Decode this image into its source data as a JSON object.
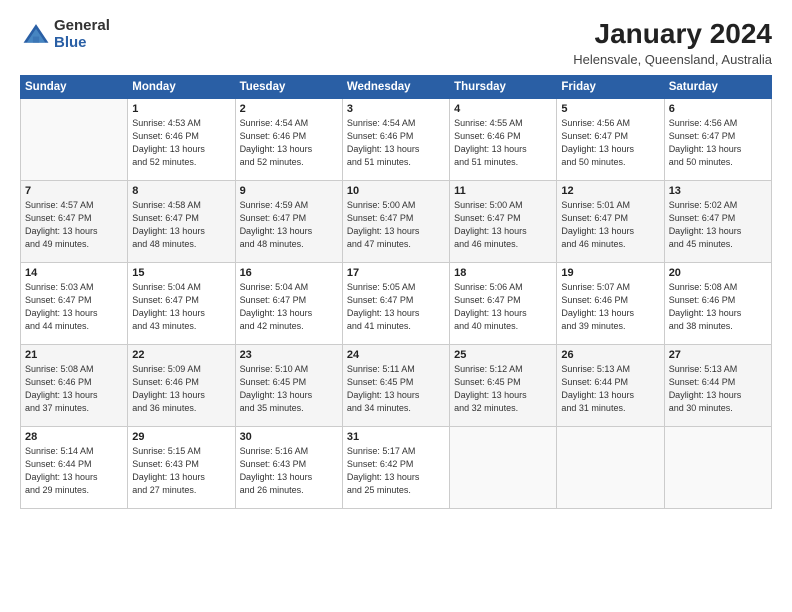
{
  "logo": {
    "general": "General",
    "blue": "Blue"
  },
  "title": {
    "month_year": "January 2024",
    "location": "Helensvale, Queensland, Australia"
  },
  "header_days": [
    "Sunday",
    "Monday",
    "Tuesday",
    "Wednesday",
    "Thursday",
    "Friday",
    "Saturday"
  ],
  "weeks": [
    {
      "days": [
        {
          "num": "",
          "content": ""
        },
        {
          "num": "1",
          "content": "Sunrise: 4:53 AM\nSunset: 6:46 PM\nDaylight: 13 hours\nand 52 minutes."
        },
        {
          "num": "2",
          "content": "Sunrise: 4:54 AM\nSunset: 6:46 PM\nDaylight: 13 hours\nand 52 minutes."
        },
        {
          "num": "3",
          "content": "Sunrise: 4:54 AM\nSunset: 6:46 PM\nDaylight: 13 hours\nand 51 minutes."
        },
        {
          "num": "4",
          "content": "Sunrise: 4:55 AM\nSunset: 6:46 PM\nDaylight: 13 hours\nand 51 minutes."
        },
        {
          "num": "5",
          "content": "Sunrise: 4:56 AM\nSunset: 6:47 PM\nDaylight: 13 hours\nand 50 minutes."
        },
        {
          "num": "6",
          "content": "Sunrise: 4:56 AM\nSunset: 6:47 PM\nDaylight: 13 hours\nand 50 minutes."
        }
      ]
    },
    {
      "days": [
        {
          "num": "7",
          "content": "Sunrise: 4:57 AM\nSunset: 6:47 PM\nDaylight: 13 hours\nand 49 minutes."
        },
        {
          "num": "8",
          "content": "Sunrise: 4:58 AM\nSunset: 6:47 PM\nDaylight: 13 hours\nand 48 minutes."
        },
        {
          "num": "9",
          "content": "Sunrise: 4:59 AM\nSunset: 6:47 PM\nDaylight: 13 hours\nand 48 minutes."
        },
        {
          "num": "10",
          "content": "Sunrise: 5:00 AM\nSunset: 6:47 PM\nDaylight: 13 hours\nand 47 minutes."
        },
        {
          "num": "11",
          "content": "Sunrise: 5:00 AM\nSunset: 6:47 PM\nDaylight: 13 hours\nand 46 minutes."
        },
        {
          "num": "12",
          "content": "Sunrise: 5:01 AM\nSunset: 6:47 PM\nDaylight: 13 hours\nand 46 minutes."
        },
        {
          "num": "13",
          "content": "Sunrise: 5:02 AM\nSunset: 6:47 PM\nDaylight: 13 hours\nand 45 minutes."
        }
      ]
    },
    {
      "days": [
        {
          "num": "14",
          "content": "Sunrise: 5:03 AM\nSunset: 6:47 PM\nDaylight: 13 hours\nand 44 minutes."
        },
        {
          "num": "15",
          "content": "Sunrise: 5:04 AM\nSunset: 6:47 PM\nDaylight: 13 hours\nand 43 minutes."
        },
        {
          "num": "16",
          "content": "Sunrise: 5:04 AM\nSunset: 6:47 PM\nDaylight: 13 hours\nand 42 minutes."
        },
        {
          "num": "17",
          "content": "Sunrise: 5:05 AM\nSunset: 6:47 PM\nDaylight: 13 hours\nand 41 minutes."
        },
        {
          "num": "18",
          "content": "Sunrise: 5:06 AM\nSunset: 6:47 PM\nDaylight: 13 hours\nand 40 minutes."
        },
        {
          "num": "19",
          "content": "Sunrise: 5:07 AM\nSunset: 6:46 PM\nDaylight: 13 hours\nand 39 minutes."
        },
        {
          "num": "20",
          "content": "Sunrise: 5:08 AM\nSunset: 6:46 PM\nDaylight: 13 hours\nand 38 minutes."
        }
      ]
    },
    {
      "days": [
        {
          "num": "21",
          "content": "Sunrise: 5:08 AM\nSunset: 6:46 PM\nDaylight: 13 hours\nand 37 minutes."
        },
        {
          "num": "22",
          "content": "Sunrise: 5:09 AM\nSunset: 6:46 PM\nDaylight: 13 hours\nand 36 minutes."
        },
        {
          "num": "23",
          "content": "Sunrise: 5:10 AM\nSunset: 6:45 PM\nDaylight: 13 hours\nand 35 minutes."
        },
        {
          "num": "24",
          "content": "Sunrise: 5:11 AM\nSunset: 6:45 PM\nDaylight: 13 hours\nand 34 minutes."
        },
        {
          "num": "25",
          "content": "Sunrise: 5:12 AM\nSunset: 6:45 PM\nDaylight: 13 hours\nand 32 minutes."
        },
        {
          "num": "26",
          "content": "Sunrise: 5:13 AM\nSunset: 6:44 PM\nDaylight: 13 hours\nand 31 minutes."
        },
        {
          "num": "27",
          "content": "Sunrise: 5:13 AM\nSunset: 6:44 PM\nDaylight: 13 hours\nand 30 minutes."
        }
      ]
    },
    {
      "days": [
        {
          "num": "28",
          "content": "Sunrise: 5:14 AM\nSunset: 6:44 PM\nDaylight: 13 hours\nand 29 minutes."
        },
        {
          "num": "29",
          "content": "Sunrise: 5:15 AM\nSunset: 6:43 PM\nDaylight: 13 hours\nand 27 minutes."
        },
        {
          "num": "30",
          "content": "Sunrise: 5:16 AM\nSunset: 6:43 PM\nDaylight: 13 hours\nand 26 minutes."
        },
        {
          "num": "31",
          "content": "Sunrise: 5:17 AM\nSunset: 6:42 PM\nDaylight: 13 hours\nand 25 minutes."
        },
        {
          "num": "",
          "content": ""
        },
        {
          "num": "",
          "content": ""
        },
        {
          "num": "",
          "content": ""
        }
      ]
    }
  ]
}
